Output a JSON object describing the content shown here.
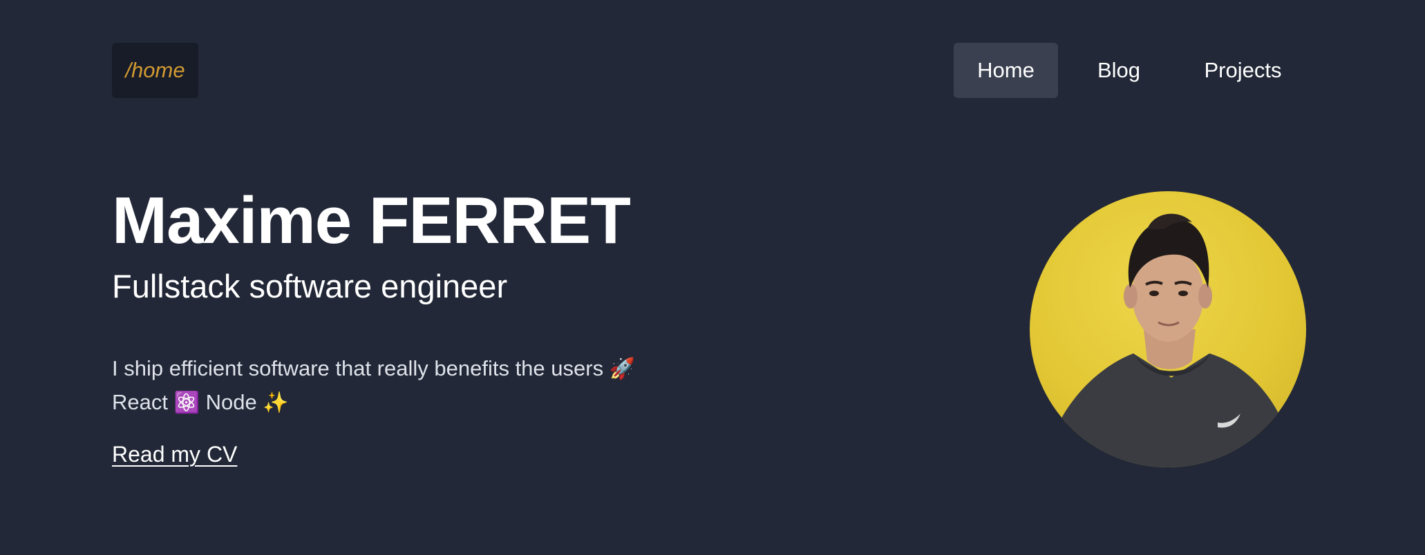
{
  "header": {
    "logo_text": "/home",
    "nav": [
      {
        "label": "Home",
        "active": true
      },
      {
        "label": "Blog",
        "active": false
      },
      {
        "label": "Projects",
        "active": false
      }
    ]
  },
  "hero": {
    "name": "Maxime FERRET",
    "title": "Fullstack software engineer",
    "bio_line1": "I ship efficient software that really benefits the users",
    "bio_line1_emoji": "🚀",
    "bio_line2_part1": "React",
    "bio_line2_emoji1": "⚛️",
    "bio_line2_part2": "Node",
    "bio_line2_emoji2": "✨",
    "cv_link": "Read my CV"
  },
  "colors": {
    "background": "#222837",
    "logo_bg": "#181c28",
    "logo_text": "#d39a31",
    "nav_active_bg": "#3a4050",
    "avatar_bg": "#e3c734"
  }
}
